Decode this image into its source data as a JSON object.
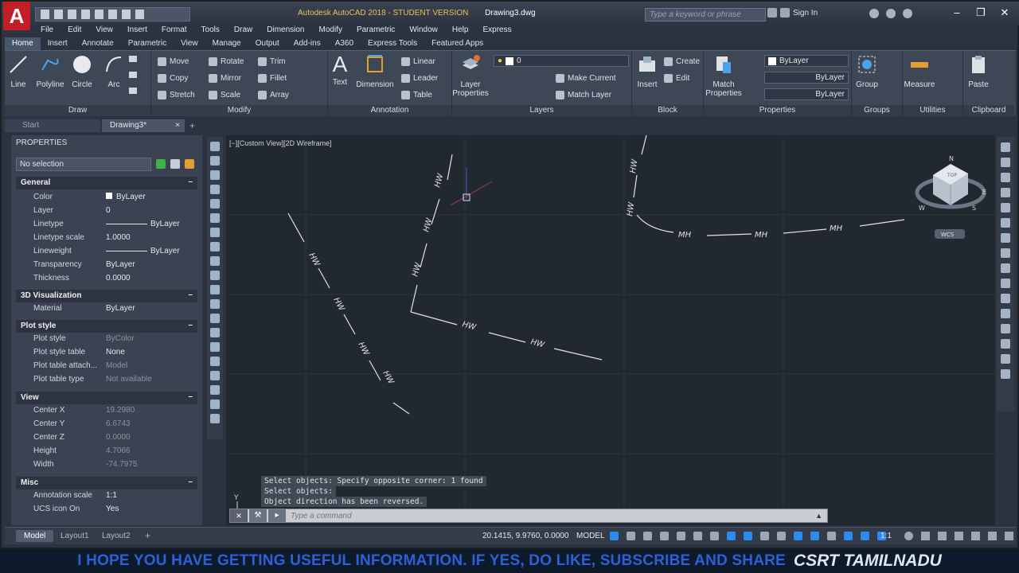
{
  "app": {
    "logo_letter": "A",
    "title": "Autodesk AutoCAD 2018 - STUDENT VERSION",
    "document": "Drawing3.dwg",
    "search_placeholder": "Type a keyword or phrase",
    "sign_in": "Sign In"
  },
  "menus": [
    "File",
    "Edit",
    "View",
    "Insert",
    "Format",
    "Tools",
    "Draw",
    "Dimension",
    "Modify",
    "Parametric",
    "Window",
    "Help",
    "Express"
  ],
  "ribbon_tabs": [
    "Home",
    "Insert",
    "Annotate",
    "Parametric",
    "View",
    "Manage",
    "Output",
    "Add-ins",
    "A360",
    "Express Tools",
    "Featured Apps"
  ],
  "ribbon": {
    "draw": {
      "title": "Draw",
      "line": "Line",
      "polyline": "Polyline",
      "circle": "Circle",
      "arc": "Arc"
    },
    "modify": {
      "title": "Modify",
      "move": "Move",
      "rotate": "Rotate",
      "trim": "Trim",
      "copy": "Copy",
      "mirror": "Mirror",
      "fillet": "Fillet",
      "stretch": "Stretch",
      "scale": "Scale",
      "array": "Array"
    },
    "annotation": {
      "title": "Annotation",
      "text": "Text",
      "dimension": "Dimension",
      "linear": "Linear",
      "leader": "Leader",
      "table": "Table"
    },
    "layers": {
      "title": "Layers",
      "layer_properties_1": "Layer",
      "layer_properties_2": "Properties",
      "current_layer": "0",
      "make_current": "Make Current",
      "match_layer": "Match Layer"
    },
    "block": {
      "title": "Block",
      "insert": "Insert",
      "create": "Create",
      "edit": "Edit"
    },
    "properties": {
      "title": "Properties",
      "match_1": "Match",
      "match_2": "Properties",
      "color": "ByLayer",
      "linetype": "ByLayer",
      "lineweight": "ByLayer"
    },
    "groups": {
      "title": "Groups",
      "group": "Group"
    },
    "utilities": {
      "title": "Utilities",
      "measure": "Measure"
    },
    "clipboard": {
      "title": "Clipboard",
      "paste": "Paste"
    }
  },
  "doc_tabs": {
    "start": "Start",
    "drawing": "Drawing3*"
  },
  "palette": {
    "header": "PROPERTIES",
    "selection": "No selection",
    "general": {
      "title": "General",
      "rows": [
        {
          "k": "Color",
          "v": "ByLayer"
        },
        {
          "k": "Layer",
          "v": "0"
        },
        {
          "k": "Linetype",
          "v": "ByLayer"
        },
        {
          "k": "Linetype scale",
          "v": "1.0000"
        },
        {
          "k": "Lineweight",
          "v": "ByLayer"
        },
        {
          "k": "Transparency",
          "v": "ByLayer"
        },
        {
          "k": "Thickness",
          "v": "0.0000"
        }
      ]
    },
    "viz": {
      "title": "3D Visualization",
      "rows": [
        {
          "k": "Material",
          "v": "ByLayer"
        }
      ]
    },
    "plot": {
      "title": "Plot style",
      "rows": [
        {
          "k": "Plot style",
          "v": "ByColor"
        },
        {
          "k": "Plot style table",
          "v": "None"
        },
        {
          "k": "Plot table attach...",
          "v": "Model"
        },
        {
          "k": "Plot table type",
          "v": "Not available"
        }
      ]
    },
    "view": {
      "title": "View",
      "rows": [
        {
          "k": "Center X",
          "v": "19.2980"
        },
        {
          "k": "Center Y",
          "v": "6.6743"
        },
        {
          "k": "Center Z",
          "v": "0.0000"
        },
        {
          "k": "Height",
          "v": "4.7066"
        },
        {
          "k": "Width",
          "v": "-74.7975"
        }
      ]
    },
    "misc": {
      "title": "Misc",
      "rows": [
        {
          "k": "Annotation scale",
          "v": "1:1"
        },
        {
          "k": "UCS icon On",
          "v": "Yes"
        }
      ]
    }
  },
  "viewport": {
    "label": "[−][Custom View][2D Wireframe]",
    "linetype_marker": "HW",
    "linetype_marker_reversed": "MH",
    "wcs": "WCS",
    "viewcube_top": "TOP",
    "viewcube_n": "N",
    "viewcube_w": "W",
    "viewcube_s": "S",
    "viewcube_e": "E",
    "ucs_y": "Y"
  },
  "command": {
    "history": [
      "Select objects: Specify opposite corner: 1 found",
      "Select objects:",
      "Object direction has been reversed."
    ],
    "placeholder": "Type a command"
  },
  "status": {
    "layouts": [
      "Model",
      "Layout1",
      "Layout2"
    ],
    "coordinates": "20.1415, 9.9760, 0.0000",
    "model": "MODEL",
    "scale": "1:1"
  },
  "banner": {
    "message": "I HOPE YOU HAVE GETTING USEFUL INFORMATION. IF YES, DO LIKE, SUBSCRIBE AND SHARE",
    "brand": "CSRT TAMILNADU"
  },
  "colors": {
    "accent": "#2c8cf0",
    "logo": "#c21e25",
    "canvas": "#212830"
  }
}
